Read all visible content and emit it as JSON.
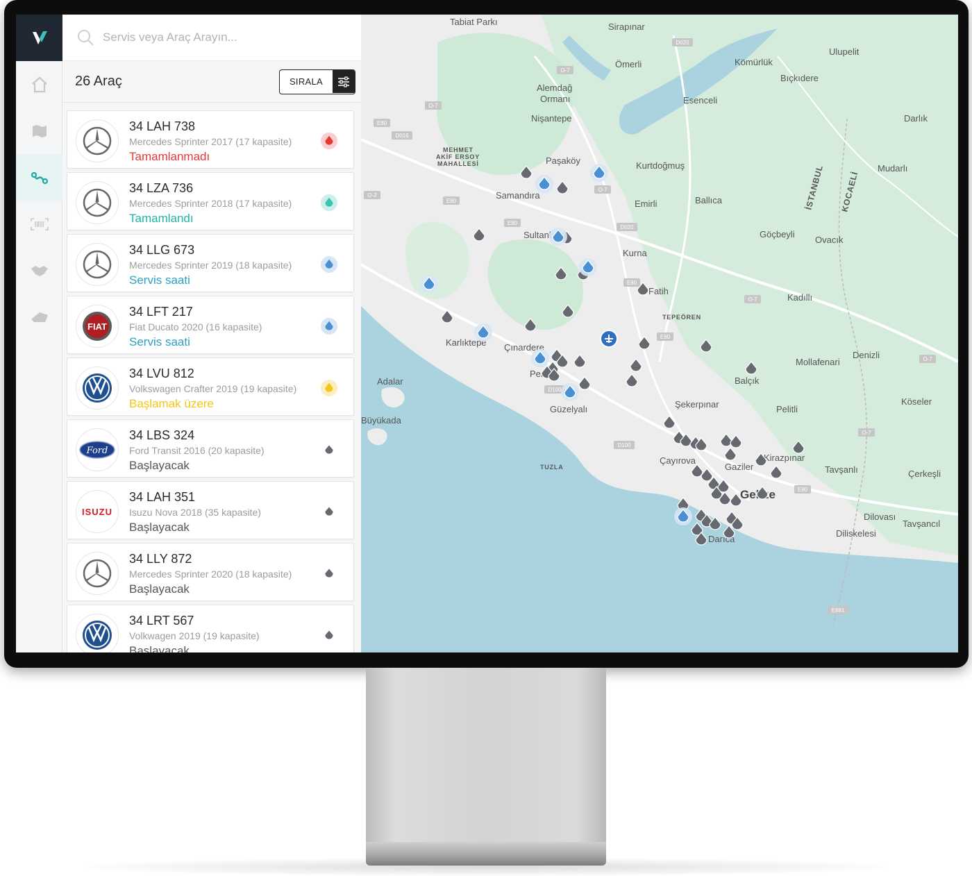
{
  "search": {
    "placeholder": "Servis veya Araç Arayın..."
  },
  "list": {
    "count_label": "26 Araç",
    "sort_label": "SIRALA"
  },
  "rail": {
    "items": [
      "home-icon",
      "map-icon",
      "route-icon",
      "barcode-icon",
      "handshake-icon",
      "ticket-icon"
    ],
    "active": "route-icon"
  },
  "colors": {
    "completed_red": "#e53935",
    "completed_teal": "#1fb5a8",
    "service_blue": "#2ea0c4",
    "starting_yellow": "#f5c518",
    "pending_gray": "#555555",
    "pin_blue": "#4a8fd1",
    "pin_gray": "#666a70"
  },
  "vehicles": [
    {
      "plate": "34 LAH 738",
      "model": "Mercedes Sprinter 2017 (17 kapasite)",
      "status": "Tamamlanmadı",
      "brand": "mercedes-logo",
      "state": "red"
    },
    {
      "plate": "34 LZA 736",
      "model": "Mercedes Sprinter 2018 (17 kapasite)",
      "status": "Tamamlandı",
      "brand": "mercedes-logo",
      "state": "teal"
    },
    {
      "plate": "34 LLG 673",
      "model": "Mercedes Sprinter 2019 (18 kapasite)",
      "status": "Servis saati",
      "brand": "mercedes-logo",
      "state": "blue"
    },
    {
      "plate": "34 LFT 217",
      "model": "Fiat Ducato 2020 (16 kapasite)",
      "status": "Servis saati",
      "brand": "fiat-logo",
      "state": "blue"
    },
    {
      "plate": "34 LVU 812",
      "model": "Volkswagen Crafter 2019 (19 kapasite)",
      "status": "Başlamak üzere",
      "brand": "vw-logo",
      "state": "yellow"
    },
    {
      "plate": "34 LBS 324",
      "model": "Ford Transit 2016 (20 kapasite)",
      "status": "Başlayacak",
      "brand": "ford-logo",
      "state": "gray"
    },
    {
      "plate": "34 LAH 351",
      "model": "Isuzu Nova 2018 (35 kapasite)",
      "status": "Başlayacak",
      "brand": "isuzu-logo",
      "state": "gray"
    },
    {
      "plate": "34 LLY 872",
      "model": "Mercedes Sprinter 2020 (18 kapasite)",
      "status": "Başlayacak",
      "brand": "mercedes-logo",
      "state": "gray"
    },
    {
      "plate": "34 LRT 567",
      "model": "Volkwagen 2019 (19 kapasite)",
      "status": "Başlayacak",
      "brand": "vw-logo",
      "state": "gray"
    }
  ],
  "map": {
    "places": [
      "Tabiat Parkı",
      "Sirapınar",
      "Ömerli",
      "Kömürlük",
      "Ulupelit",
      "Bıçkıdere",
      "Alemdağ",
      "Ormanı",
      "Esenceli",
      "Darlık",
      "Nişantepe",
      "MEHMET",
      "AKİF ERSOY",
      "MAHALLESİ",
      "Paşaköy",
      "Kurtdoğmuş",
      "Mudarlı",
      "Samandıra",
      "Emirli",
      "Ballıca",
      "İSTANBUL",
      "KOCAELİ",
      "Göçbeyli",
      "Ovacık",
      "Sultanbeyli",
      "Kurna",
      "Fatih",
      "Kadıllı",
      "TEPEÖREN",
      "Karlıktepe",
      "Çınardere",
      "Mollafenari",
      "Denizli",
      "Adalar",
      "Balçık",
      "Pendik",
      "Güzelyalı",
      "Köseler",
      "Şekerpınar",
      "Pelitli",
      "Büyükada",
      "TUZLA",
      "Çayırova",
      "Gaziler",
      "Kirazpınar",
      "Tavşanlı",
      "Çerkeşli",
      "Gebze",
      "Darıca",
      "Dilovası",
      "Diliskelesi",
      "Tavşancıl"
    ],
    "roads": [
      "D020",
      "O-7",
      "E80",
      "D016",
      "O-2",
      "D100",
      "E881"
    ]
  }
}
